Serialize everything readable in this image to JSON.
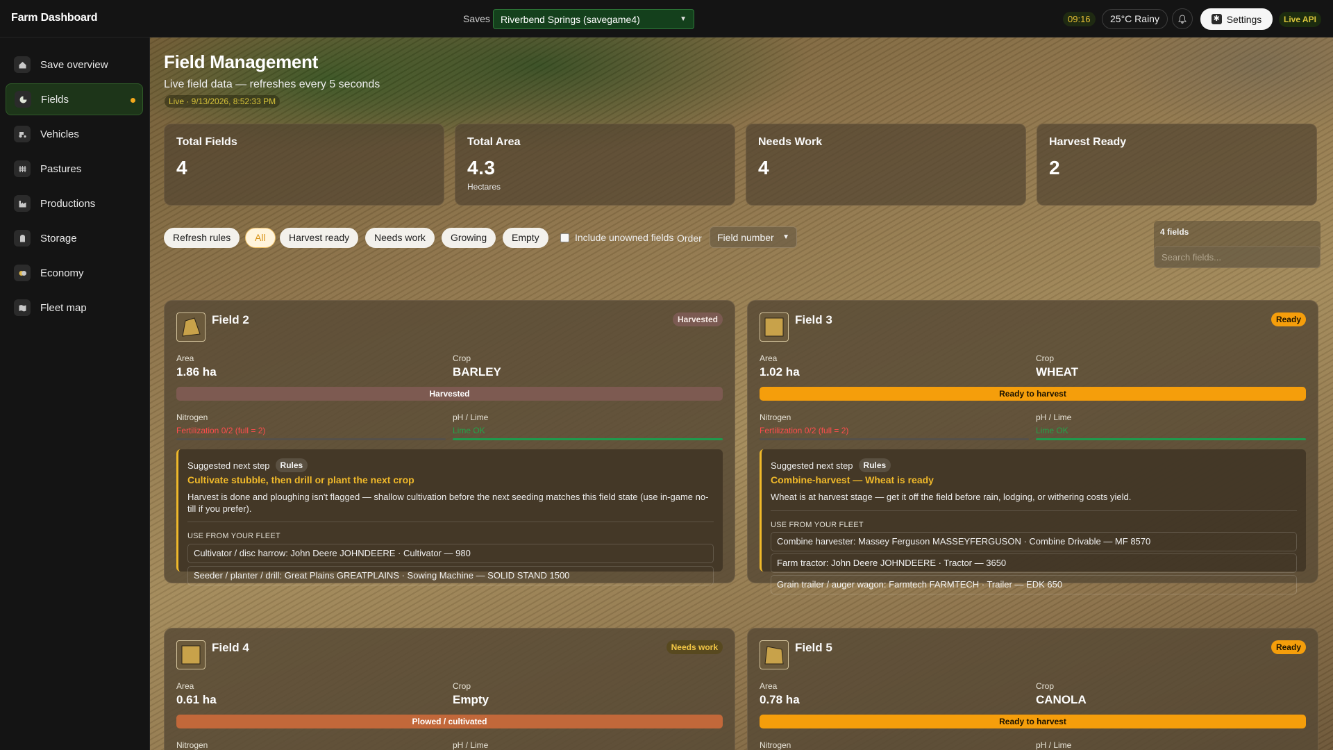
{
  "app": {
    "brand": "Farm Dashboard"
  },
  "topbar": {
    "saves_label": "Saves",
    "saves_selected": "Riverbend Springs (savegame4)",
    "clock": "09:16",
    "weather": "25°C Rainy",
    "settings_label": "Settings",
    "live_api": "Live API"
  },
  "sidebar": {
    "items": [
      {
        "label": "Save overview",
        "icon": "home-icon"
      },
      {
        "label": "Fields",
        "icon": "field-icon",
        "active": true
      },
      {
        "label": "Vehicles",
        "icon": "tractor-icon"
      },
      {
        "label": "Pastures",
        "icon": "animal-icon"
      },
      {
        "label": "Productions",
        "icon": "factory-icon"
      },
      {
        "label": "Storage",
        "icon": "silo-icon"
      },
      {
        "label": "Economy",
        "icon": "money-icon"
      },
      {
        "label": "Fleet map",
        "icon": "map-icon"
      }
    ]
  },
  "page": {
    "title": "Field Management",
    "subtitle": "Live field data — refreshes every 5 seconds",
    "live_stamp": "Live · 9/13/2026, 8:52:33 PM"
  },
  "stats": [
    {
      "label": "Total Fields",
      "value": "4",
      "unit": ""
    },
    {
      "label": "Total Area",
      "value": "4.3",
      "unit": "Hectares"
    },
    {
      "label": "Needs Work",
      "value": "4",
      "unit": ""
    },
    {
      "label": "Harvest Ready",
      "value": "2",
      "unit": ""
    }
  ],
  "filters": {
    "refresh": "Refresh rules",
    "chips": [
      "All",
      "Harvest ready",
      "Needs work",
      "Growing",
      "Empty"
    ],
    "include_unowned": "Include unowned fields",
    "order_label": "Order",
    "order_value": "Field number",
    "count": "4 fields",
    "search_placeholder": "Search fields..."
  },
  "labels": {
    "area": "Area",
    "crop": "Crop",
    "nitrogen": "Nitrogen",
    "ph": "pH / Lime",
    "suggested": "Suggested next step",
    "rules": "Rules",
    "use_fleet": "USE FROM YOUR FLEET"
  },
  "fields": [
    {
      "name": "Field 2",
      "badge": "Harvested",
      "area": "1.86 ha",
      "crop": "BARLEY",
      "status": "Harvested",
      "nitrogen": "Fertilization 0/2 (full = 2)",
      "ph": "Lime OK",
      "suggest_title": "Cultivate stubble, then drill or plant the next crop",
      "suggest_desc": "Harvest is done and ploughing isn't flagged — shallow cultivation before the next seeding matches this field state (use in-game no-till if you prefer).",
      "fleet": [
        "Cultivator / disc harrow: John Deere JOHNDEERE · Cultivator — 980",
        "Seeder / planter / drill: Great Plains GREATPLAINS · Sowing Machine — SOLID STAND 1500"
      ]
    },
    {
      "name": "Field 3",
      "badge": "Ready",
      "area": "1.02 ha",
      "crop": "WHEAT",
      "status": "Ready to harvest",
      "nitrogen": "Fertilization 0/2 (full = 2)",
      "ph": "Lime OK",
      "suggest_title": "Combine-harvest — Wheat is ready",
      "suggest_desc": "Wheat is at harvest stage — get it off the field before rain, lodging, or withering costs yield.",
      "fleet": [
        "Combine harvester: Massey Ferguson MASSEYFERGUSON · Combine Drivable — MF 8570",
        "Farm tractor: John Deere JOHNDEERE · Tractor — 3650",
        "Grain trailer / auger wagon: Farmtech FARMTECH · Trailer — EDK 650"
      ]
    },
    {
      "name": "Field 4",
      "badge": "Needs work",
      "area": "0.61 ha",
      "crop": "Empty",
      "status": "Plowed / cultivated"
    },
    {
      "name": "Field 5",
      "badge": "Ready",
      "area": "0.78 ha",
      "crop": "CANOLA",
      "status": "Ready to harvest"
    }
  ]
}
